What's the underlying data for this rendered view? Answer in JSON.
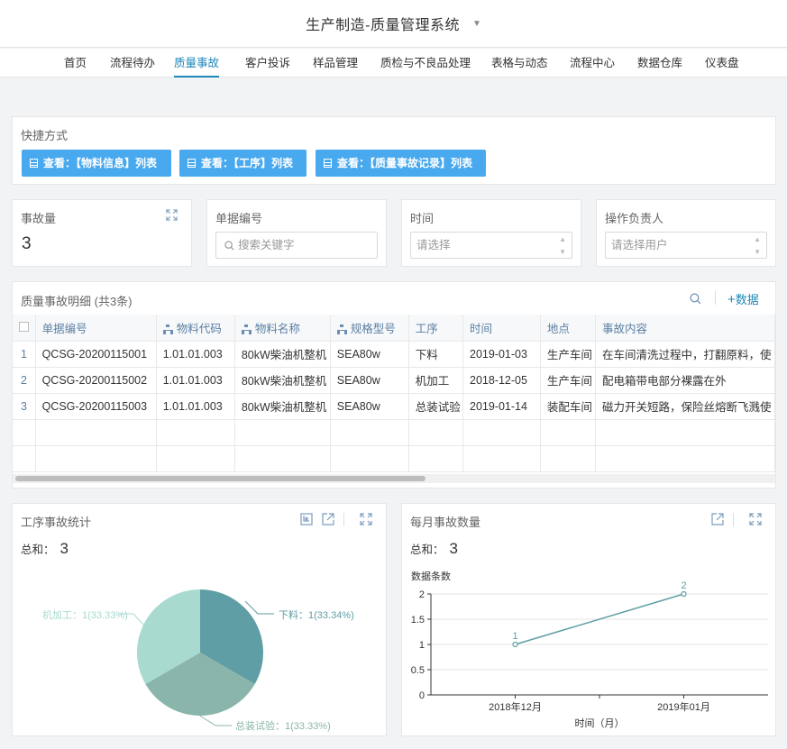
{
  "app": {
    "title": "生产制造-质量管理系统"
  },
  "nav": {
    "items": [
      "首页",
      "流程待办",
      "质量事故",
      "客户投诉",
      "样品管理",
      "质检与不良品处理",
      "表格与动态",
      "流程中心",
      "数据仓库",
      "仪表盘"
    ],
    "active": "质量事故"
  },
  "shortcuts": {
    "title": "快捷方式",
    "buttons": [
      "查看：【物料信息】列表",
      "查看：【工序】列表",
      "查看：【质量事故记录】列表"
    ]
  },
  "filters": {
    "count_label": "事故量",
    "count_value": "3",
    "doc_no_label": "单据编号",
    "doc_no_placeholder": "搜索关键字",
    "time_label": "时间",
    "time_placeholder": "请选择",
    "owner_label": "操作负责人",
    "owner_placeholder": "请选择用户"
  },
  "table": {
    "title": "质量事故明细 (共3条)",
    "add_label": "数据",
    "columns": [
      "单据编号",
      "物料代码",
      "物料名称",
      "规格型号",
      "工序",
      "时间",
      "地点",
      "事故内容"
    ],
    "rows": [
      [
        "1",
        "QCSG-20200115001",
        "1.01.01.003",
        "80kW柴油机整机",
        "SEA80w",
        "下料",
        "2019-01-03",
        "生产车间",
        "在车间清洗过程中，打翻原料，使"
      ],
      [
        "2",
        "QCSG-20200115002",
        "1.01.01.003",
        "80kW柴油机整机",
        "SEA80w",
        "机加工",
        "2018-12-05",
        "生产车间",
        "配电箱带电部分裸露在外"
      ],
      [
        "3",
        "QCSG-20200115003",
        "1.01.01.003",
        "80kW柴油机整机",
        "SEA80w",
        "总装试验",
        "2019-01-14",
        "装配车间",
        "磁力开关短路，保险丝熔断飞溅使"
      ]
    ]
  },
  "pie_panel": {
    "title": "工序事故统计",
    "sum_label": "总和：",
    "sum_value": "3"
  },
  "line_panel": {
    "title": "每月事故数量",
    "sum_label": "总和：",
    "sum_value": "3"
  },
  "colors": {
    "accent": "#1e88b6",
    "button": "#49a9ee",
    "pie1": "#5f9ea5",
    "pie2": "#8ab5aa",
    "pie3": "#a8dad0",
    "line": "#5f9ea5"
  },
  "chart_data": [
    {
      "type": "pie",
      "categories": [
        "下料",
        "总装试验",
        "机加工"
      ],
      "values": [
        1,
        1,
        1
      ],
      "labels": [
        "下料：1(33.34%)",
        "总装试验：1(33.33%)",
        "机加工：1(33.33%)"
      ]
    },
    {
      "type": "line",
      "categories": [
        "2018年12月",
        "2019年01月"
      ],
      "values": [
        1,
        2
      ],
      "ylabel": "数据条数",
      "xlabel": "时间（月）",
      "ylim": [
        0,
        2
      ],
      "yticks": [
        "0",
        "0.5",
        "1",
        "1.5",
        "2"
      ],
      "grid": true
    }
  ]
}
